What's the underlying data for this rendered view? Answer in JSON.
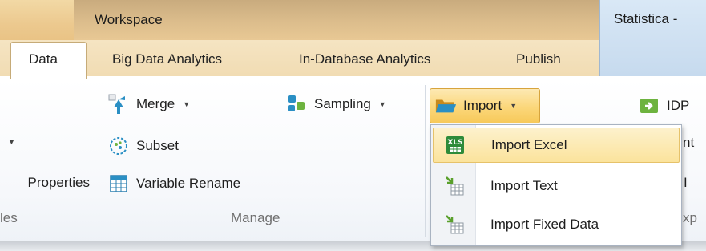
{
  "titlebar": {
    "workspace": "Workspace",
    "app_title": "Statistica -"
  },
  "tabs": [
    {
      "label": "Data",
      "active": true
    },
    {
      "label": "Big Data Analytics"
    },
    {
      "label": "In-Database Analytics"
    },
    {
      "label": "Publish"
    }
  ],
  "left_group": {
    "properties_label": "Properties",
    "group_label": "les"
  },
  "manage_group": {
    "merge_label": "Merge",
    "subset_label": "Subset",
    "variable_rename_label": "Variable Rename",
    "sampling_label": "Sampling",
    "group_label": "Manage"
  },
  "import": {
    "button_label": "Import",
    "menu": [
      {
        "label": "Import Excel",
        "icon": "xls-icon",
        "highlighted": true
      },
      {
        "label": "Import Text",
        "icon": "import-text-icon"
      },
      {
        "label": "Import Fixed Data",
        "icon": "import-fixed-data-icon"
      }
    ]
  },
  "right_group": {
    "idp_label": "IDP",
    "partial_1": "nt",
    "partial_2": "I",
    "partial_3": "xp"
  },
  "colors": {
    "active_highlight": "#fbd77a",
    "title_bar": "#ecc98f",
    "ribbon_bg": "#ffffff",
    "app_title_bg": "#d9e8f6"
  }
}
